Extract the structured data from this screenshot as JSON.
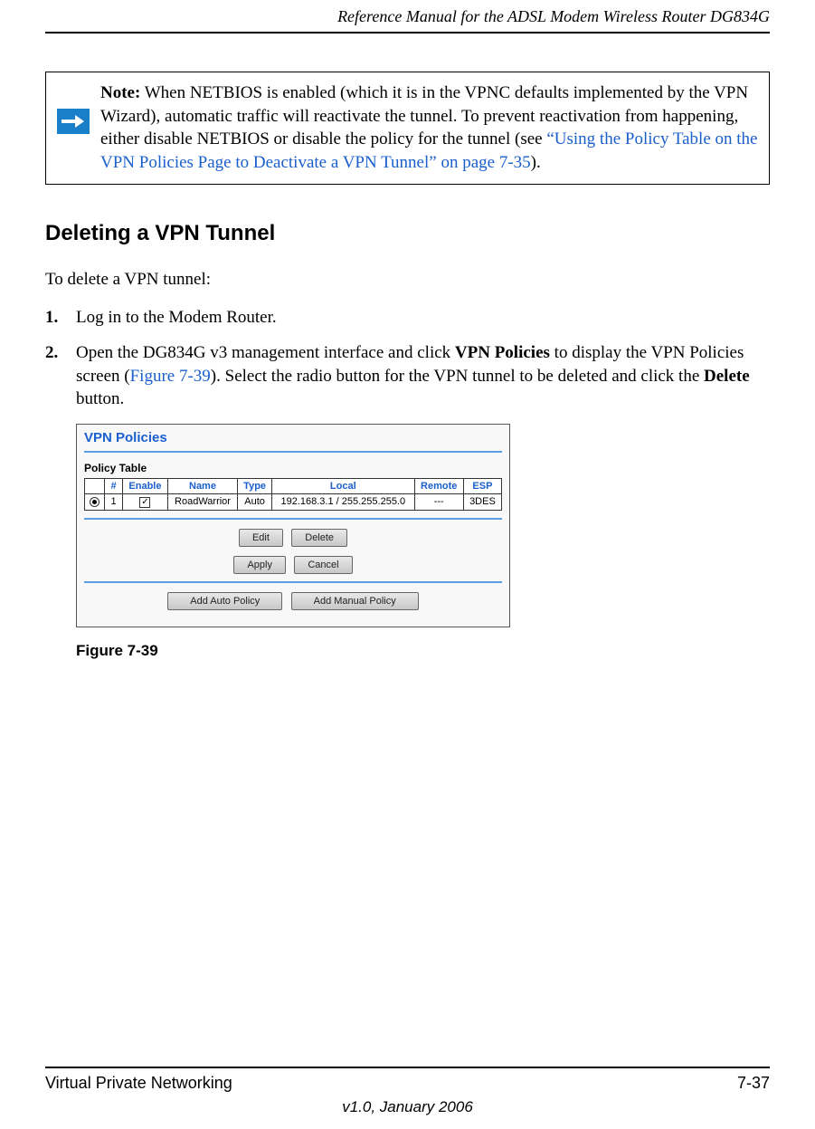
{
  "header": {
    "title": "Reference Manual for the ADSL Modem Wireless Router DG834G"
  },
  "note": {
    "label": "Note:",
    "text_part1": " When NETBIOS is enabled (which it is in the VPNC defaults implemented by the VPN Wizard), automatic traffic will reactivate the tunnel. To prevent reactivation from happening, either disable NETBIOS or disable the policy for the tunnel (see ",
    "link_text": "“Using the Policy Table on the VPN Policies Page to Deactivate a VPN Tunnel” on page 7-35",
    "text_part2": ")."
  },
  "section": {
    "heading": "Deleting a VPN Tunnel",
    "intro": "To delete a VPN tunnel:"
  },
  "steps": [
    {
      "num": "1.",
      "text": "Log in to the Modem Router."
    },
    {
      "num": "2.",
      "prefix": "Open the DG834G v3 management interface and click ",
      "bold1": "VPN Policies",
      "mid1": " to display the VPN Policies screen (",
      "link": "Figure 7-39",
      "mid2": "). Select the radio button for the VPN tunnel to be deleted and click the ",
      "bold2": "Delete",
      "suffix": " button."
    }
  ],
  "figure": {
    "panel_title": "VPN Policies",
    "subhead": "Policy Table",
    "headers": {
      "radio": "",
      "num": "#",
      "enable": "Enable",
      "name": "Name",
      "type": "Type",
      "local": "Local",
      "remote": "Remote",
      "esp": "ESP"
    },
    "row": {
      "num": "1",
      "name": "RoadWarrior",
      "type": "Auto",
      "local": "192.168.3.1 / 255.255.255.0",
      "remote": "---",
      "esp": "3DES"
    },
    "buttons": {
      "edit": "Edit",
      "delete": "Delete",
      "apply": "Apply",
      "cancel": "Cancel",
      "add_auto": "Add Auto Policy",
      "add_manual": "Add Manual Policy"
    },
    "caption": "Figure 7-39"
  },
  "footer": {
    "left": "Virtual Private Networking",
    "right": "7-37",
    "version": "v1.0, January 2006"
  }
}
